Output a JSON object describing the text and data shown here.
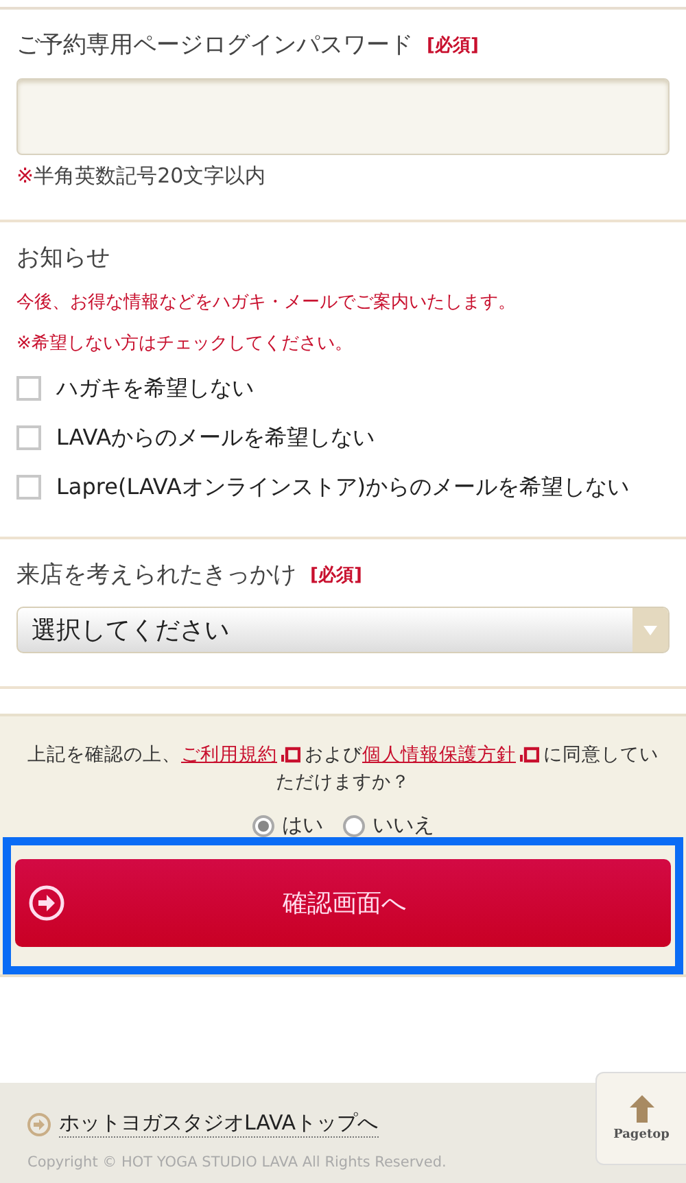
{
  "password_section": {
    "label": "ご予約専用ページログインパスワード",
    "required": "[必須]",
    "note_mark": "※",
    "note": "半角英数記号20文字以内"
  },
  "notice_section": {
    "heading": "お知らせ",
    "messages": [
      "今後、お得な情報などをハガキ・メールでご案内いたします。",
      "※希望しない方はチェックしてください。"
    ],
    "options": [
      {
        "label": "ハガキを希望しない",
        "checked": false
      },
      {
        "label": "LAVAからのメールを希望しない",
        "checked": false
      },
      {
        "label": "Lapre(LAVAオンラインストア)からのメールを希望しない",
        "checked": false
      }
    ]
  },
  "reason_section": {
    "label": "来店を考えられたきっかけ",
    "required": "[必須]",
    "select": {
      "value": "選択してください"
    }
  },
  "agreement": {
    "parts": [
      {
        "kind": "text",
        "text": "上記を確認の上、"
      },
      {
        "kind": "link",
        "text": "ご利用規約"
      },
      {
        "kind": "text",
        "text": "および"
      },
      {
        "kind": "link",
        "text": "個人情報保護方針"
      },
      {
        "kind": "text",
        "text": "に同意していただけますか？"
      }
    ],
    "choices": [
      {
        "label": "はい",
        "selected": true
      },
      {
        "label": "いいえ",
        "selected": false
      }
    ],
    "submit": "確認画面へ",
    "highlighted": true
  },
  "footer": {
    "top_link": "ホットヨガスタジオLAVAトップへ",
    "copyright": "Copyright © HOT YOGA STUDIO LAVA All Rights Reserved.",
    "pagetop": "Pagetop"
  }
}
